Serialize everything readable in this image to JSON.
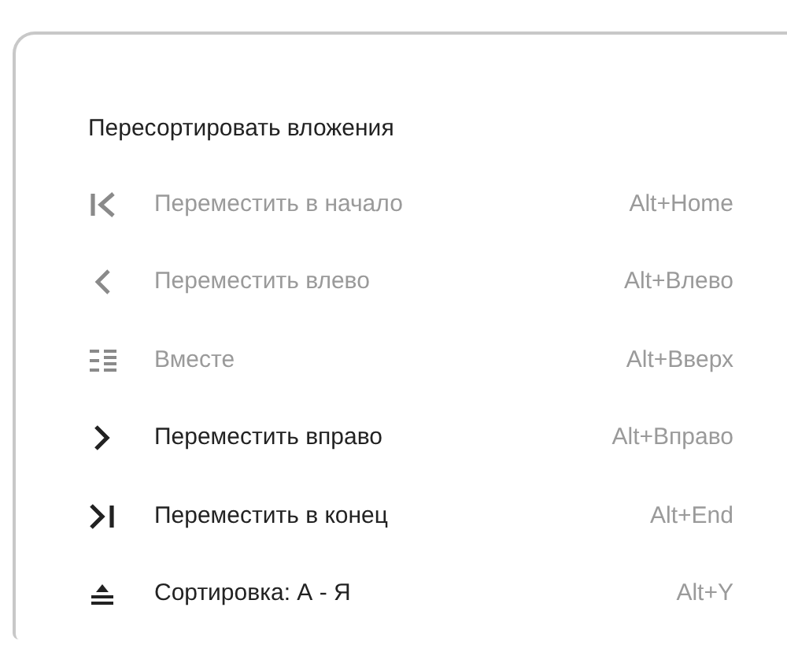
{
  "menu": {
    "title": "Пересортировать вложения",
    "items": [
      {
        "kind": "first",
        "label": "Переместить в начало",
        "shortcut": "Alt+Home",
        "disabled": true
      },
      {
        "kind": "prev",
        "label": "Переместить влево",
        "shortcut": "Alt+Влево",
        "disabled": true
      },
      {
        "kind": "group",
        "label": "Вместе",
        "shortcut": "Alt+Вверх",
        "disabled": true
      },
      {
        "kind": "next",
        "label": "Переместить вправо",
        "shortcut": "Alt+Вправо",
        "disabled": false
      },
      {
        "kind": "last",
        "label": "Переместить в конец",
        "shortcut": "Alt+End",
        "disabled": false
      },
      {
        "kind": "sort",
        "label": "Сортировка: А - Я",
        "shortcut": "Alt+Y",
        "disabled": false
      }
    ]
  }
}
